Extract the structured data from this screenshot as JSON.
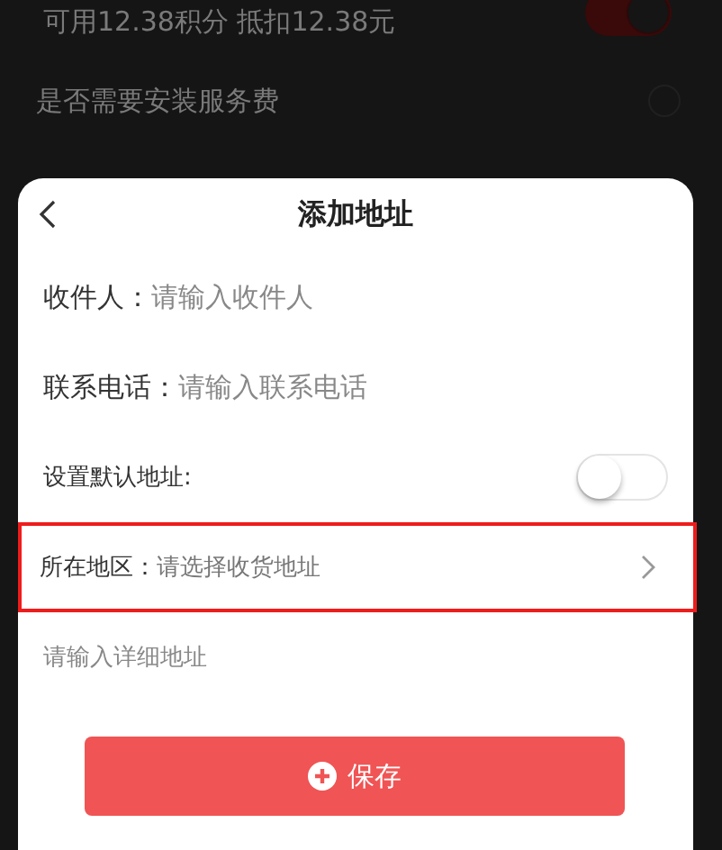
{
  "background": {
    "points_row": {
      "text": "可用12.38积分 抵扣12.38元",
      "on": true
    },
    "service_row": {
      "label": "是否需要安装服务费",
      "checked": false
    }
  },
  "dialog": {
    "title": "添加地址",
    "fields": [
      {
        "kind": "input",
        "label": "收件人：",
        "placeholder": "请输入收件人"
      },
      {
        "kind": "input",
        "label": "联系电话：",
        "placeholder": "请输入联系电话"
      },
      {
        "kind": "switch",
        "label": "设置默认地址:",
        "on": false
      },
      {
        "kind": "select",
        "label": "所在地区：",
        "placeholder": "请选择收货地址",
        "highlighted": true
      },
      {
        "kind": "textarea",
        "placeholder": "请输入详细地址"
      }
    ],
    "save_button": "保存"
  }
}
